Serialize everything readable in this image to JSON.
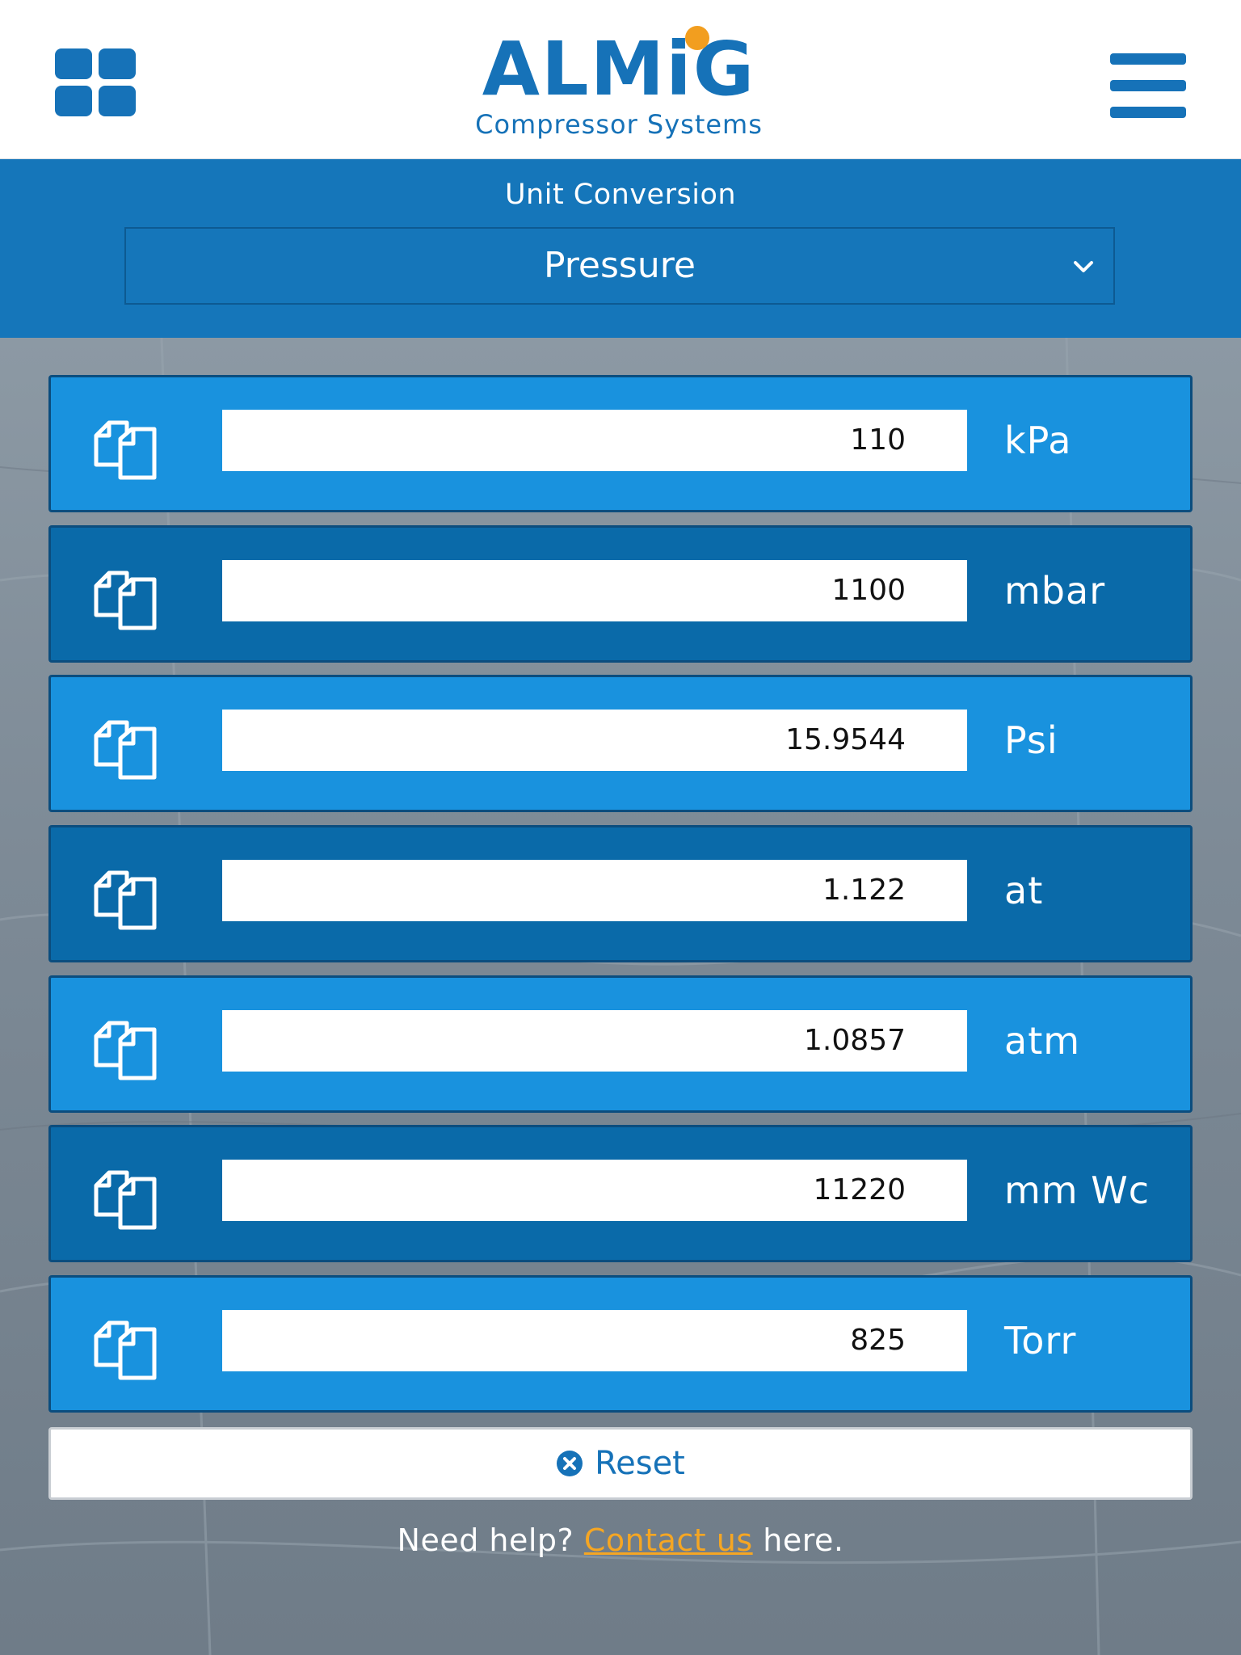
{
  "header": {
    "logo_text": "ALMiG",
    "logo_subtitle": "Compressor Systems",
    "apps_icon": "grid-icon",
    "menu_icon": "hamburger-menu-icon"
  },
  "selector": {
    "title": "Unit Conversion",
    "selected": "Pressure"
  },
  "rows": [
    {
      "value": "110",
      "unit": "kPa"
    },
    {
      "value": "1100",
      "unit": "mbar"
    },
    {
      "value": "15.9544",
      "unit": "Psi"
    },
    {
      "value": "1.122",
      "unit": "at"
    },
    {
      "value": "1.0857",
      "unit": "atm"
    },
    {
      "value": "11220",
      "unit": "mm Wc"
    },
    {
      "value": "825",
      "unit": "Torr"
    }
  ],
  "reset": {
    "label": "Reset"
  },
  "help": {
    "prefix": "Need help?",
    "link": "Contact us",
    "suffix": "here."
  },
  "colors": {
    "brand_blue": "#1672b8",
    "row_light": "#1992de",
    "row_dark": "#0a6aa9",
    "accent_orange": "#f5a623"
  }
}
